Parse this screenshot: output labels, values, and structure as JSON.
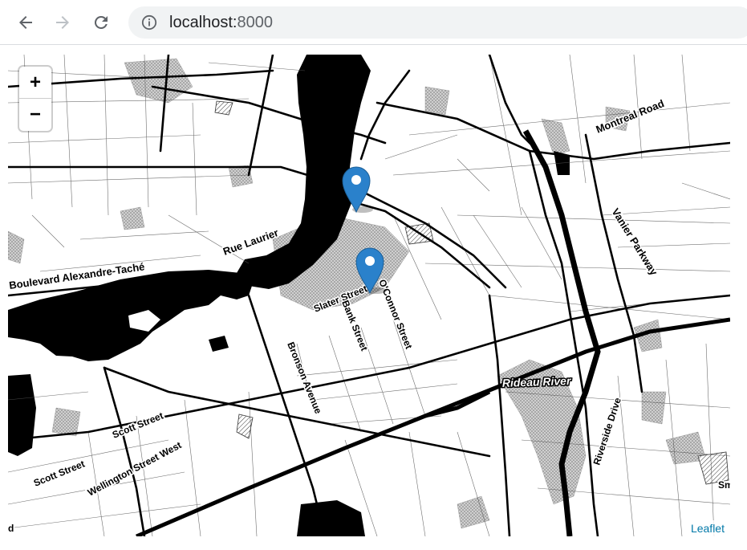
{
  "browser": {
    "url_host": "localhost:",
    "url_port": "8000",
    "back_icon": "arrow-left-icon",
    "forward_icon": "arrow-right-icon",
    "reload_icon": "reload-icon",
    "info_icon": "info-circle-icon"
  },
  "map": {
    "zoom_in_label": "+",
    "zoom_out_label": "−",
    "attribution": "Leaflet",
    "marker_color": "#2a81cb",
    "water_color": "#000000",
    "markers": [
      {
        "name": "marker-north",
        "icon": "map-marker-icon"
      },
      {
        "name": "marker-south",
        "icon": "map-marker-icon"
      }
    ],
    "labels": {
      "montreal_road": "Montreal Road",
      "vanier_parkway": "Vanier Parkway",
      "rue_laurier": "Rue Laurier",
      "boulevard": "Boulevard Alexandre-Taché",
      "slater": "Slater Street",
      "oconnor": "O'Connor Street",
      "bank": "Bank Street",
      "bronson": "Bronson Avenue",
      "rideau_river": "Rideau River",
      "riverside": "Riverside Drive",
      "scott1": "Scott Street",
      "scott2": "Scott Street",
      "wellington": "Wellington Street West",
      "edge_sm": "Sm",
      "edge_d": "d"
    }
  }
}
